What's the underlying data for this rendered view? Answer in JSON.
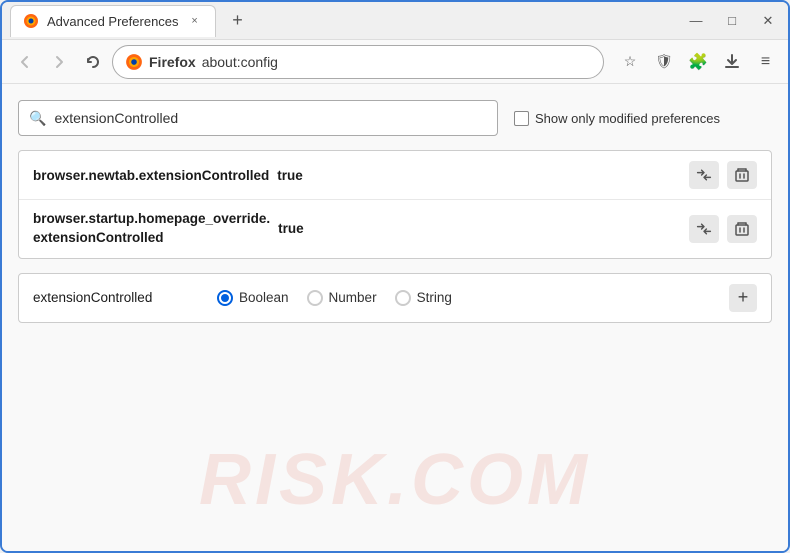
{
  "window": {
    "title": "Advanced Preferences",
    "tab_close_label": "×",
    "new_tab_label": "+",
    "minimize_label": "—",
    "maximize_label": "□",
    "close_label": "✕"
  },
  "nav": {
    "back_title": "Back",
    "forward_title": "Forward",
    "reload_title": "Reload",
    "browser_name": "Firefox",
    "url": "about:config",
    "bookmark_icon": "☆",
    "shield_icon": "🛡",
    "extension_icon": "🧩",
    "menu_icon": "≡"
  },
  "search": {
    "value": "extensionControlled",
    "placeholder": "Search preference name",
    "show_modified_label": "Show only modified preferences"
  },
  "results": [
    {
      "name": "browser.newtab.extensionControlled",
      "value": "true"
    },
    {
      "name_line1": "browser.startup.homepage_override.",
      "name_line2": "extensionControlled",
      "value": "true"
    }
  ],
  "add_row": {
    "name": "extensionControlled",
    "type_options": [
      "Boolean",
      "Number",
      "String"
    ],
    "selected_type": "Boolean",
    "add_button_label": "+"
  },
  "watermark": "RISK.COM"
}
